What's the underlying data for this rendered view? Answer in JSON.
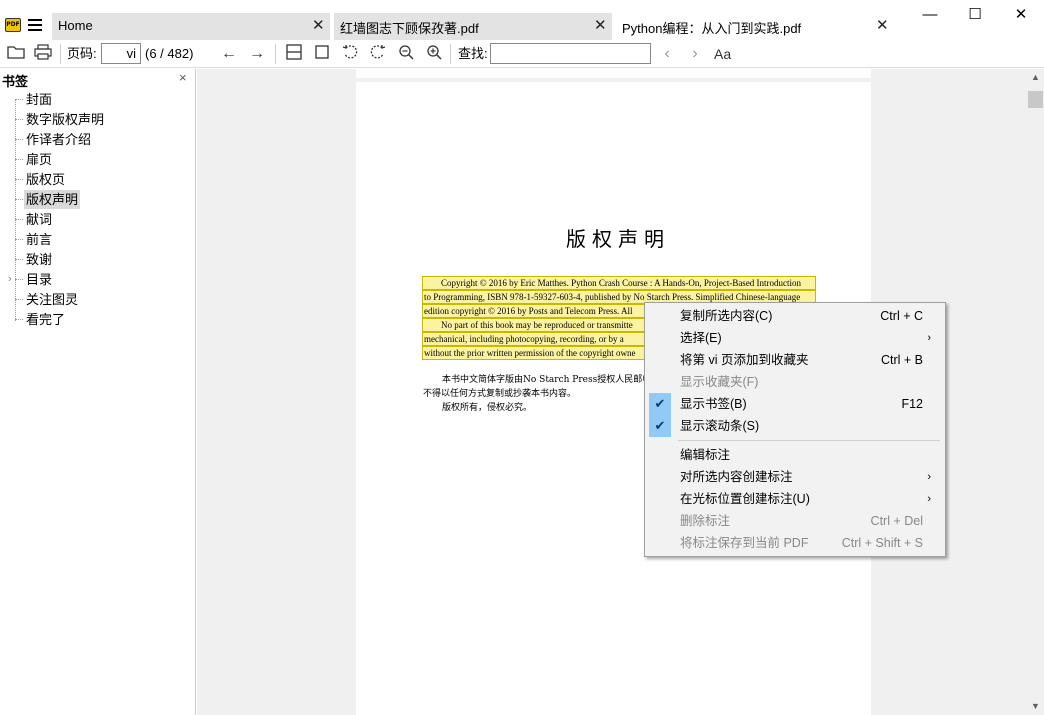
{
  "app": {
    "icon_text": "PDF"
  },
  "tabs": [
    {
      "label": "Home"
    },
    {
      "label": "红墙图志下顾保孜著.pdf"
    },
    {
      "label": "Python编程：从入门到实践.pdf"
    }
  ],
  "window_controls": {
    "minimize": "—",
    "maximize": "☐",
    "close": "✕"
  },
  "toolbar": {
    "page_label": "页码:",
    "page_value": "vi",
    "page_count": "(6 / 482)",
    "find_label": "查找:",
    "find_value": "",
    "match_case": "Aa"
  },
  "sidebar": {
    "title": "书签",
    "close": "×",
    "items": [
      {
        "label": "封面"
      },
      {
        "label": "数字版权声明"
      },
      {
        "label": "作译者介绍"
      },
      {
        "label": "扉页"
      },
      {
        "label": "版权页"
      },
      {
        "label": "版权声明",
        "selected": true
      },
      {
        "label": "献词"
      },
      {
        "label": "前言"
      },
      {
        "label": "致谢"
      },
      {
        "label": "目录",
        "has_children": true
      },
      {
        "label": "关注图灵"
      },
      {
        "label": "看完了"
      }
    ]
  },
  "document": {
    "heading": "版权声明",
    "highlight_lines": [
      "Copyright © 2016 by Eric Matthes. Python Crash Course : A Hands-On, Project-Based Introduction",
      "to Programming, ISBN 978-1-59327-603-4, published by No Starch Press. Simplified Chinese-language",
      "edition copyright © 2016 by Posts and Telecom Press. All",
      "No part of this book may be reproduced or transmitte",
      "mechanical, including photocopying, recording, or by a",
      "without the prior written permission of the copyright owne"
    ],
    "cn_lines": [
      "本书中文简体字版由No Starch Press授权人民邮电",
      "不得以任何方式复制或抄袭本书内容。",
      "版权所有，侵权必究。"
    ]
  },
  "context_menu": {
    "items": [
      {
        "label": "复制所选内容(C)",
        "shortcut": "Ctrl + C"
      },
      {
        "label": "选择(E)",
        "submenu": true
      },
      {
        "label": "将第 vi 页添加到收藏夹",
        "shortcut": "Ctrl + B"
      },
      {
        "label": "显示收藏夹(F)",
        "disabled": true
      },
      {
        "label": "显示书签(B)",
        "shortcut": "F12",
        "checked": true
      },
      {
        "label": "显示滚动条(S)",
        "checked": true
      },
      {
        "label": "编辑标注"
      },
      {
        "label": "对所选内容创建标注",
        "submenu": true
      },
      {
        "label": "在光标位置创建标注(U)",
        "submenu": true
      },
      {
        "label": "删除标注",
        "shortcut": "Ctrl + Del",
        "disabled": true
      },
      {
        "label": "将标注保存到当前 PDF",
        "shortcut": "Ctrl + Shift + S",
        "disabled": true
      }
    ]
  },
  "colors": {
    "highlight": "#fbf3a1",
    "highlight_border": "#c8b800",
    "menu_check": "#91c9f7",
    "tab_inactive": "#e3e3e3",
    "canvas": "#f0f0f0"
  }
}
